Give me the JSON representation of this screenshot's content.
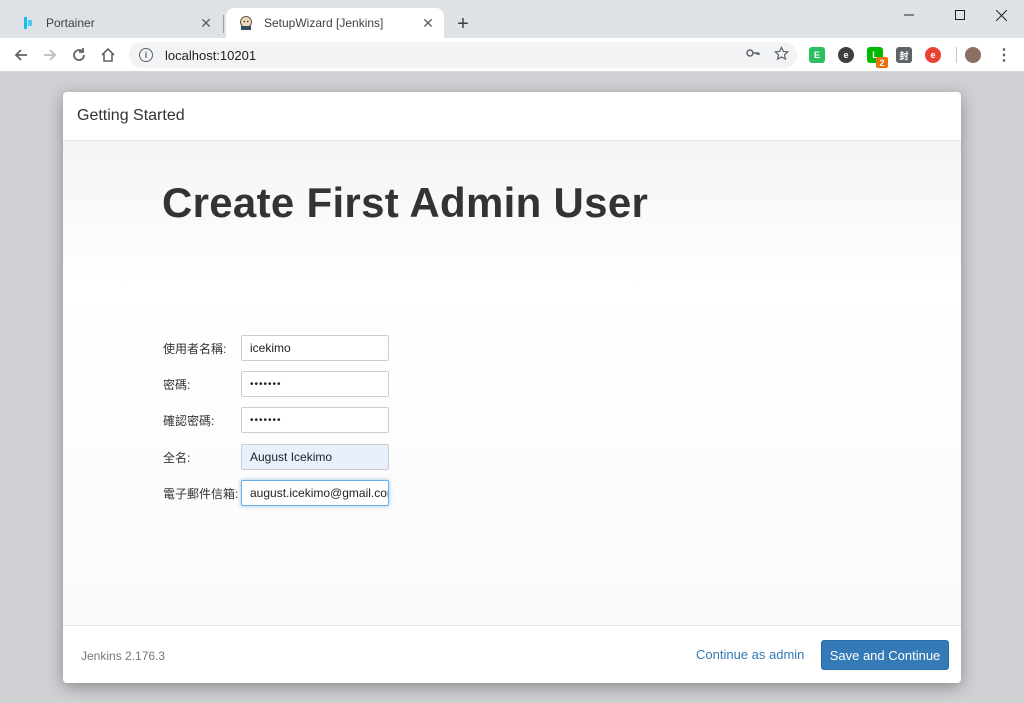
{
  "browser": {
    "tabs": [
      {
        "label": "Portainer",
        "favicon": "portainer-icon",
        "active": false
      },
      {
        "label": "SetupWizard [Jenkins]",
        "favicon": "jenkins-icon",
        "active": true
      }
    ],
    "new_tab": "+",
    "address": "localhost:10201",
    "window_controls": {
      "minimize": "—",
      "maximize": "☐",
      "close": "✕"
    },
    "extensions": [
      {
        "name": "evernote-icon",
        "color": "#2dbe60"
      },
      {
        "name": "extension-e-icon",
        "color": "#3c4043"
      },
      {
        "name": "line-icon",
        "color": "#00b900",
        "badge": "2"
      },
      {
        "name": "extension-feng-icon",
        "color": "#5f6368",
        "text": "封"
      },
      {
        "name": "extension-red-icon",
        "color": "#e94235"
      }
    ]
  },
  "dialog": {
    "header_title": "Getting Started",
    "form_title": "Create First Admin User",
    "fields": [
      {
        "label": "使用者名稱:",
        "value": "icekimo",
        "type": "text"
      },
      {
        "label": "密碼:",
        "value": "•••••••",
        "type": "password"
      },
      {
        "label": "確認密碼:",
        "value": "•••••••",
        "type": "password"
      },
      {
        "label": "全名:",
        "value": "August Icekimo",
        "type": "text",
        "autofill": true
      },
      {
        "label": "電子郵件信箱:",
        "value": "august.icekimo@gmail.com",
        "type": "email",
        "focused": true
      }
    ],
    "footer": {
      "version": "Jenkins 2.176.3",
      "continue_admin": "Continue as admin",
      "save_continue": "Save and Continue"
    }
  },
  "colors": {
    "primary": "#337ab7",
    "link": "#337ab7",
    "page_bg": "#cfd1d4"
  }
}
